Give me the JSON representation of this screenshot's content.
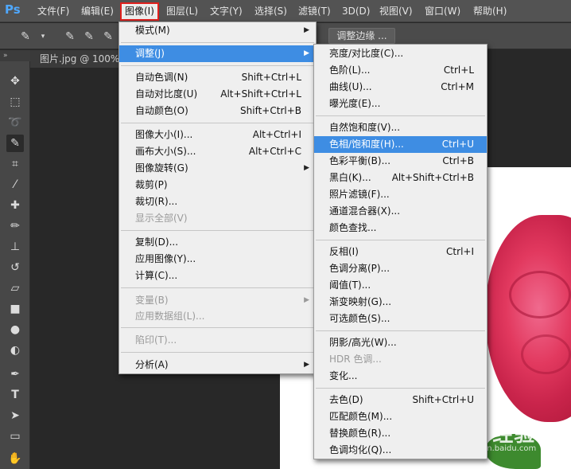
{
  "menubar": {
    "logo": "Ps",
    "items": [
      "文件(F)",
      "编辑(E)",
      "图像(I)",
      "图层(L)",
      "文字(Y)",
      "选择(S)",
      "滤镜(T)",
      "3D(D)",
      "视图(V)",
      "窗口(W)",
      "帮助(H)"
    ],
    "active_index": 2
  },
  "optbar": {
    "refine_edge_label": "调整边缘 ..."
  },
  "document": {
    "tab_title": "图片.jpg @ 100%("
  },
  "image_menu": {
    "items": [
      {
        "label": "模式(M)",
        "shortcut": "",
        "submenu": true,
        "disabled": false
      },
      {
        "label": "调整(J)",
        "shortcut": "",
        "submenu": true,
        "disabled": false,
        "highlighted": true
      },
      {
        "label": "自动色调(N)",
        "shortcut": "Shift+Ctrl+L"
      },
      {
        "label": "自动对比度(U)",
        "shortcut": "Alt+Shift+Ctrl+L"
      },
      {
        "label": "自动颜色(O)",
        "shortcut": "Shift+Ctrl+B"
      },
      {
        "label": "图像大小(I)...",
        "shortcut": "Alt+Ctrl+I"
      },
      {
        "label": "画布大小(S)...",
        "shortcut": "Alt+Ctrl+C"
      },
      {
        "label": "图像旋转(G)",
        "shortcut": "",
        "submenu": true
      },
      {
        "label": "裁剪(P)",
        "shortcut": ""
      },
      {
        "label": "裁切(R)...",
        "shortcut": ""
      },
      {
        "label": "显示全部(V)",
        "shortcut": "",
        "disabled": true
      },
      {
        "label": "复制(D)...",
        "shortcut": ""
      },
      {
        "label": "应用图像(Y)...",
        "shortcut": ""
      },
      {
        "label": "计算(C)...",
        "shortcut": ""
      },
      {
        "label": "变量(B)",
        "shortcut": "",
        "submenu": true,
        "disabled": true
      },
      {
        "label": "应用数据组(L)...",
        "shortcut": "",
        "disabled": true
      },
      {
        "label": "陷印(T)...",
        "shortcut": "",
        "disabled": true
      },
      {
        "label": "分析(A)",
        "shortcut": "",
        "submenu": true
      }
    ]
  },
  "adjust_menu": {
    "items": [
      {
        "label": "亮度/对比度(C)...",
        "shortcut": ""
      },
      {
        "label": "色阶(L)...",
        "shortcut": "Ctrl+L"
      },
      {
        "label": "曲线(U)...",
        "shortcut": "Ctrl+M"
      },
      {
        "label": "曝光度(E)...",
        "shortcut": ""
      },
      {
        "label": "自然饱和度(V)...",
        "shortcut": ""
      },
      {
        "label": "色相/饱和度(H)...",
        "shortcut": "Ctrl+U",
        "highlighted": true
      },
      {
        "label": "色彩平衡(B)...",
        "shortcut": "Ctrl+B"
      },
      {
        "label": "黑白(K)...",
        "shortcut": "Alt+Shift+Ctrl+B"
      },
      {
        "label": "照片滤镜(F)...",
        "shortcut": ""
      },
      {
        "label": "通道混合器(X)...",
        "shortcut": ""
      },
      {
        "label": "颜色查找...",
        "shortcut": ""
      },
      {
        "label": "反相(I)",
        "shortcut": "Ctrl+I"
      },
      {
        "label": "色调分离(P)...",
        "shortcut": ""
      },
      {
        "label": "阈值(T)...",
        "shortcut": ""
      },
      {
        "label": "渐变映射(G)...",
        "shortcut": ""
      },
      {
        "label": "可选颜色(S)...",
        "shortcut": ""
      },
      {
        "label": "阴影/高光(W)...",
        "shortcut": ""
      },
      {
        "label": "HDR 色调...",
        "shortcut": "",
        "disabled": true
      },
      {
        "label": "变化...",
        "shortcut": ""
      },
      {
        "label": "去色(D)",
        "shortcut": "Shift+Ctrl+U"
      },
      {
        "label": "匹配颜色(M)...",
        "shortcut": ""
      },
      {
        "label": "替换颜色(R)...",
        "shortcut": ""
      },
      {
        "label": "色调均化(Q)...",
        "shortcut": ""
      }
    ]
  },
  "watermark": {
    "brand": "Bai 经验",
    "url": "jingyan.baidu.com"
  },
  "colors": {
    "highlight": "#3e8de3",
    "menubar": "#535353",
    "active_outline": "#e0201d"
  }
}
